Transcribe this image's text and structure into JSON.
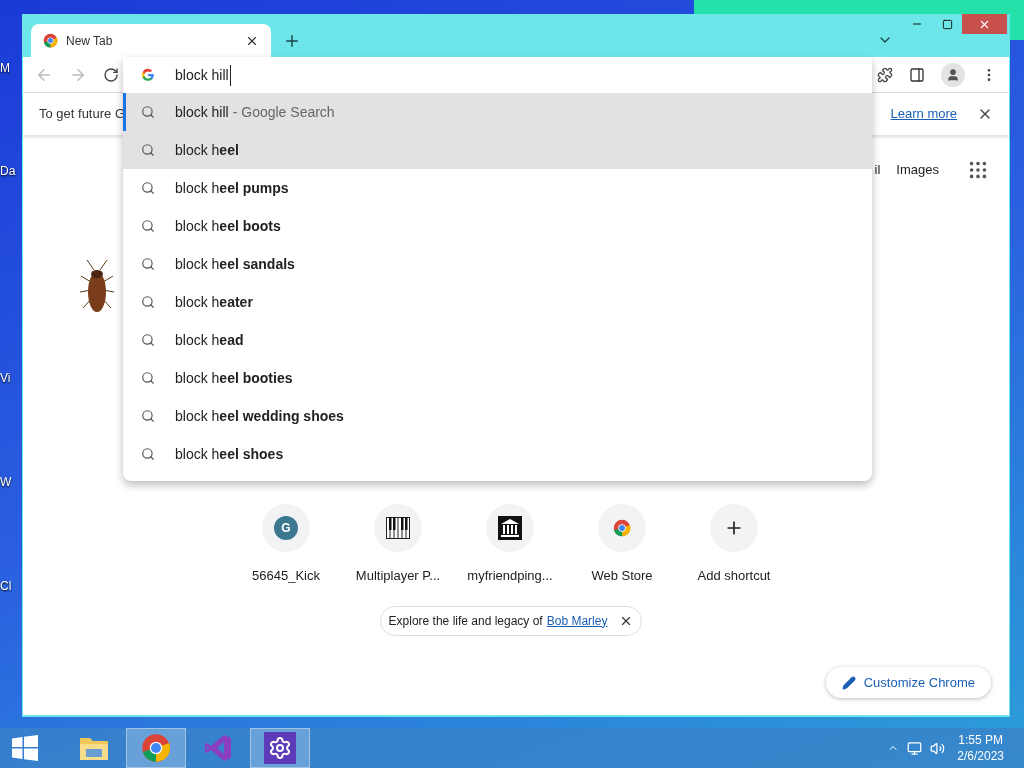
{
  "desktop": {
    "icon_labels": [
      "M",
      "Da",
      "Vi",
      "W",
      "Cl"
    ]
  },
  "window": {
    "tabs": [
      {
        "title": "New Tab",
        "selected": true
      }
    ],
    "omnibox": {
      "value": "block hill"
    },
    "infobar": {
      "text": "To get future G",
      "link": "Learn more"
    },
    "suggestions": [
      {
        "text": "block hill",
        "description": "- Google Search",
        "selected": true,
        "highlighted": true
      },
      {
        "text": "block h**eel**",
        "selected": false,
        "highlighted": true
      },
      {
        "text": "block h**eel pumps**",
        "selected": false,
        "highlighted": false
      },
      {
        "text": "block h**eel boots**",
        "selected": false,
        "highlighted": false
      },
      {
        "text": "block h**eel sandals**",
        "selected": false,
        "highlighted": false
      },
      {
        "text": "block h**eater**",
        "selected": false,
        "highlighted": false
      },
      {
        "text": "block h**ead**",
        "selected": false,
        "highlighted": false
      },
      {
        "text": "block h**eel booties**",
        "selected": false,
        "highlighted": false
      },
      {
        "text": "block h**eel wedding shoes**",
        "selected": false,
        "highlighted": false
      },
      {
        "text": "block h**eel shoes**",
        "selected": false,
        "highlighted": false
      }
    ],
    "header_links": [
      "il",
      "Images"
    ],
    "shortcuts": [
      {
        "kind": "letter",
        "letter": "G",
        "label": "56645_Kick"
      },
      {
        "kind": "piano",
        "label": "Multiplayer P..."
      },
      {
        "kind": "building",
        "label": "myfriendping..."
      },
      {
        "kind": "store",
        "label": "Web Store"
      },
      {
        "kind": "add",
        "label": "Add shortcut"
      }
    ],
    "promo": {
      "text": "Explore the life and legacy of",
      "link": "Bob Marley"
    },
    "customize_button": "Customize Chrome"
  },
  "taskbar": {
    "apps": [
      {
        "kind": "explorer",
        "selected": false
      },
      {
        "kind": "chrome",
        "selected": true
      },
      {
        "kind": "studio",
        "selected": false
      },
      {
        "kind": "settings",
        "selected": true
      }
    ],
    "time": "1:55 PM",
    "date": "2/6/2023"
  }
}
